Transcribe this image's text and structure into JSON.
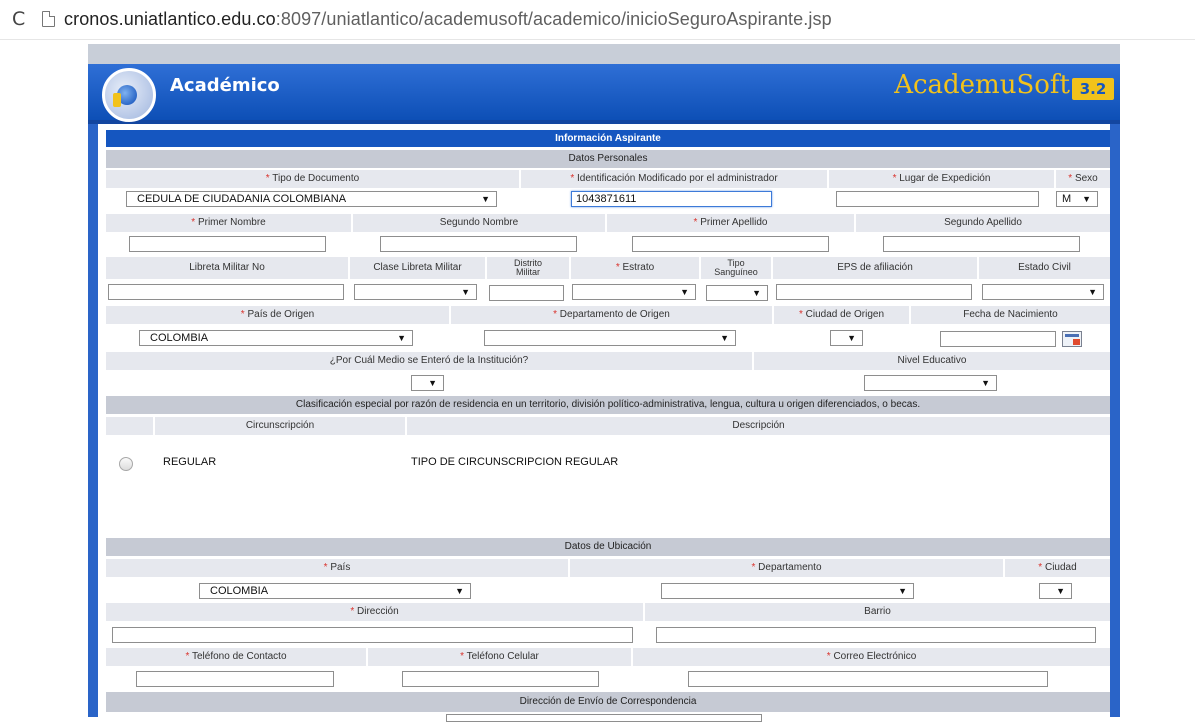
{
  "browser": {
    "url_host": "cronos.uniatlantico.edu.co",
    "url_rest": ":8097/uniatlantico/academusoft/academico/inicioSeguroAspirante.jsp"
  },
  "header": {
    "title": "Académico",
    "brand": "AcademuSoft",
    "version_badge": "3.2"
  },
  "form": {
    "title": "Información Aspirante",
    "required_mark": "*",
    "datos_personales": {
      "section": "Datos Personales",
      "tipo_documento_label": "Tipo de Documento",
      "tipo_documento_value": "CEDULA DE CIUDADANIA COLOMBIANA",
      "identificacion_label": "Identificación Modificado por el administrador",
      "identificacion_value": "1043871611",
      "lugar_expedicion_label": "Lugar de Expedición",
      "sexo_label": "Sexo",
      "sexo_value": "M",
      "primer_nombre_label": "Primer Nombre",
      "segundo_nombre_label": "Segundo Nombre",
      "primer_apellido_label": "Primer Apellido",
      "segundo_apellido_label": "Segundo Apellido",
      "libreta_militar_label": "Libreta Militar No",
      "clase_libreta_label": "Clase Libreta Militar",
      "distrito_militar_label_1": "Distrito",
      "distrito_militar_label_2": "Militar",
      "estrato_label": "Estrato",
      "tipo_sanguineo_label_1": "Tipo",
      "tipo_sanguineo_label_2": "Sanguíneo",
      "eps_label": "EPS de afiliación",
      "estado_civil_label": "Estado Civil",
      "pais_origen_label": "País de Origen",
      "pais_origen_value": "COLOMBIA",
      "depto_origen_label": "Departamento de Origen",
      "ciudad_origen_label": "Ciudad de Origen",
      "fecha_nacimiento_label": "Fecha de Nacimiento",
      "medio_label": "¿Por Cuál Medio se Enteró de la Institución?",
      "nivel_educativo_label": "Nivel Educativo"
    },
    "clasificacion": {
      "section": "Clasificación especial por razón de residencia en un territorio, división político-administrativa, lengua, cultura u origen diferenciados, o becas.",
      "col_circunscripcion": "Circunscripción",
      "col_descripcion": "Descripción",
      "rows": [
        {
          "circunscripcion": "REGULAR",
          "descripcion": "TIPO DE CIRCUNSCRIPCION REGULAR"
        }
      ]
    },
    "ubicacion": {
      "section": "Datos de Ubicación",
      "pais_label": "País",
      "pais_value": "COLOMBIA",
      "departamento_label": "Departamento",
      "ciudad_label": "Ciudad",
      "direccion_label": "Dirección",
      "barrio_label": "Barrio",
      "telefono_contacto_label": "Teléfono de Contacto",
      "telefono_celular_label": "Teléfono Celular",
      "correo_label": "Correo Electrónico",
      "envio_section": "Dirección de Envío de Correspondencia"
    }
  },
  "colors": {
    "frame_blue": "#2a64c8",
    "title_bar": "#1556c0",
    "section_gray": "#c6cad4",
    "label_gray": "#e6e8ee",
    "required_red": "#d9312b",
    "brand_yellow": "#f2c21b"
  },
  "icons": {
    "reload": "reload-icon",
    "page": "page-icon",
    "logo": "academico-logo",
    "calendar": "calendar-icon"
  }
}
